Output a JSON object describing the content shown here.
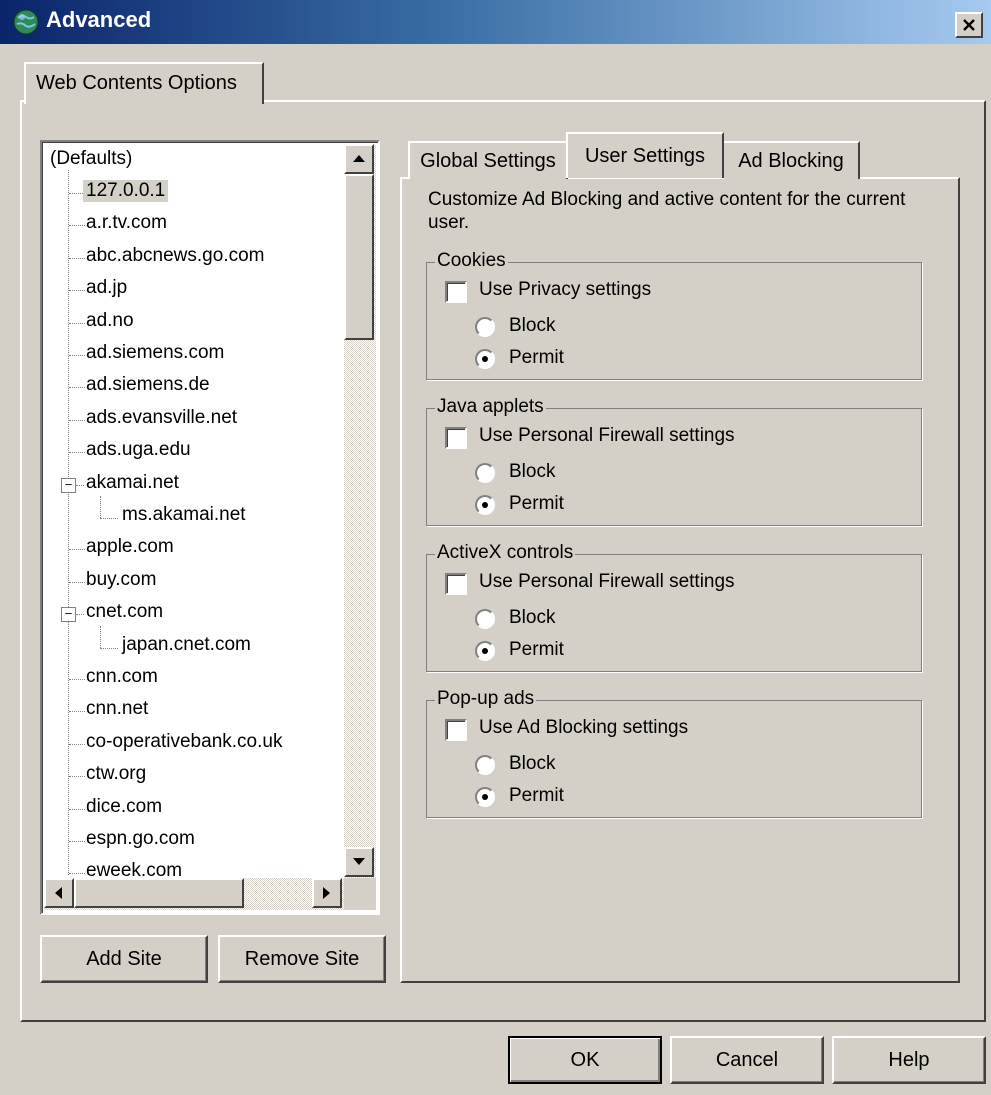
{
  "window": {
    "title": "Advanced",
    "outer_tab": "Web Contents Options"
  },
  "tree": {
    "root": "(Defaults)",
    "items": [
      "127.0.0.1",
      "a.r.tv.com",
      "abc.abcnews.go.com",
      "ad.jp",
      "ad.no",
      "ad.siemens.com",
      "ad.siemens.de",
      "ads.evansville.net",
      "ads.uga.edu",
      "akamai.net",
      "ms.akamai.net",
      "apple.com",
      "buy.com",
      "cnet.com",
      "japan.cnet.com",
      "cnn.com",
      "cnn.net",
      "co-operativebank.co.uk",
      "ctw.org",
      "dice.com",
      "espn.go.com",
      "eweek.com"
    ]
  },
  "site_buttons": {
    "add": "Add Site",
    "remove": "Remove Site"
  },
  "tabs": [
    "Global Settings",
    "User Settings",
    "Ad Blocking"
  ],
  "user_settings": {
    "description": "Customize Ad Blocking and active content for the current user.",
    "groups": [
      {
        "title": "Cookies",
        "checkbox": "Use Privacy settings",
        "block": "Block",
        "permit": "Permit"
      },
      {
        "title": "Java applets",
        "checkbox": "Use Personal Firewall settings",
        "block": "Block",
        "permit": "Permit"
      },
      {
        "title": "ActiveX controls",
        "checkbox": "Use Personal Firewall settings",
        "block": "Block",
        "permit": "Permit"
      },
      {
        "title": "Pop-up ads",
        "checkbox": "Use Ad Blocking settings",
        "block": "Block",
        "permit": "Permit"
      }
    ]
  },
  "dialog_buttons": {
    "ok": "OK",
    "cancel": "Cancel",
    "help": "Help"
  }
}
